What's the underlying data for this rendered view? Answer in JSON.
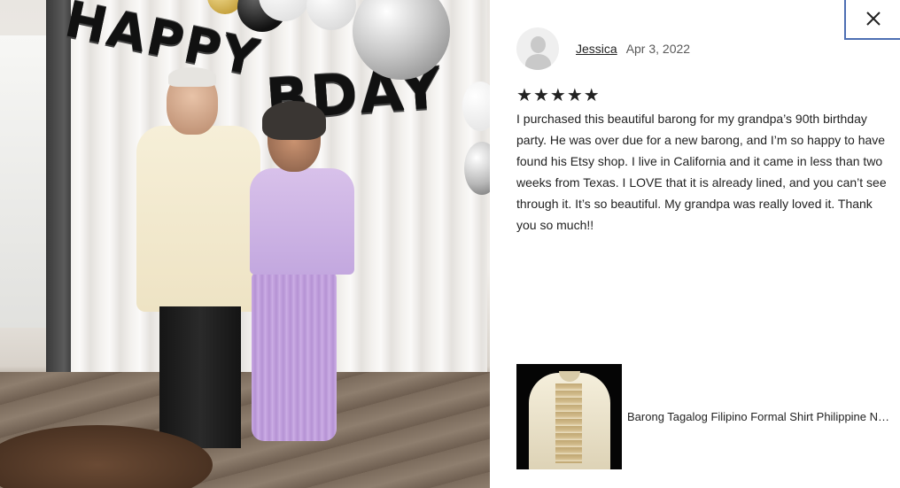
{
  "photo": {
    "banner_letters_1": "HAPPY",
    "banner_letters_2": "BDAY"
  },
  "close_button": {
    "icon": "close-icon"
  },
  "review": {
    "reviewer_name": "Jessica",
    "date": "Apr 3, 2022",
    "rating": 5,
    "stars": [
      "★",
      "★",
      "★",
      "★",
      "★"
    ],
    "text": "I purchased this beautiful barong for my grandpa’s 90th birthday party. He was over due for a new barong, and I’m so happy to have found his Etsy shop. I live in California and it came in less than two weeks from Texas. I LOVE that it is already lined, and you can’t see through it. It’s so beautiful. My grandpa was really loved it. Thank you so much!!"
  },
  "item": {
    "title": "Barong Tagalog Filipino Formal Shirt Philippine National Costume"
  },
  "colors": {
    "focus_border": "#4d6fb3",
    "text": "#222222",
    "muted": "#595959"
  }
}
